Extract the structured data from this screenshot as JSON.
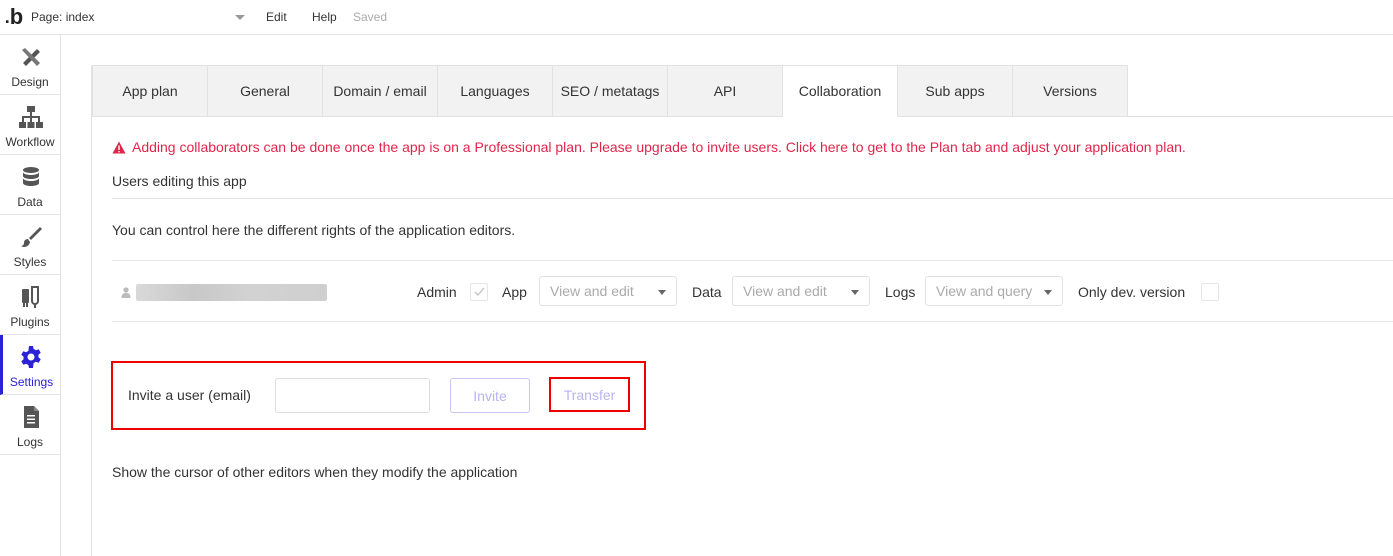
{
  "topbar": {
    "logo": "b",
    "page_select": "Page: index",
    "menu_edit": "Edit",
    "menu_help": "Help",
    "status": "Saved"
  },
  "sidebar": {
    "items": [
      {
        "label": "Design",
        "icon": "design-icon"
      },
      {
        "label": "Workflow",
        "icon": "workflow-icon"
      },
      {
        "label": "Data",
        "icon": "database-icon"
      },
      {
        "label": "Styles",
        "icon": "brush-icon"
      },
      {
        "label": "Plugins",
        "icon": "plug-icon"
      },
      {
        "label": "Settings",
        "icon": "gear-icon",
        "active": true
      },
      {
        "label": "Logs",
        "icon": "document-icon"
      }
    ]
  },
  "tabs": [
    {
      "label": "App plan"
    },
    {
      "label": "General"
    },
    {
      "label": "Domain / email"
    },
    {
      "label": "Languages"
    },
    {
      "label": "SEO / metatags"
    },
    {
      "label": "API"
    },
    {
      "label": "Collaboration",
      "active": true
    },
    {
      "label": "Sub apps"
    },
    {
      "label": "Versions"
    }
  ],
  "collaboration": {
    "warning": "Adding collaborators can be done once the app is on a Professional plan. Please upgrade to invite users. Click here to get to the Plan tab and adjust your application plan.",
    "users_title": "Users editing this app",
    "rights_text": "You can control here the different rights of the application editors.",
    "user_row": {
      "admin_label": "Admin",
      "app_label": "App",
      "app_value": "View and edit",
      "data_label": "Data",
      "data_value": "View and edit",
      "logs_label": "Logs",
      "logs_value": "View and query",
      "only_dev_label": "Only dev. version"
    },
    "invite": {
      "label": "Invite a user (email)",
      "input_value": "",
      "invite_button": "Invite",
      "transfer_button": "Transfer"
    },
    "cursor_text": "Show the cursor of other editors when they modify the application"
  },
  "colors": {
    "accent": "#2b21d6",
    "warning": "#e0264b",
    "highlight_box": "#ee0000"
  }
}
